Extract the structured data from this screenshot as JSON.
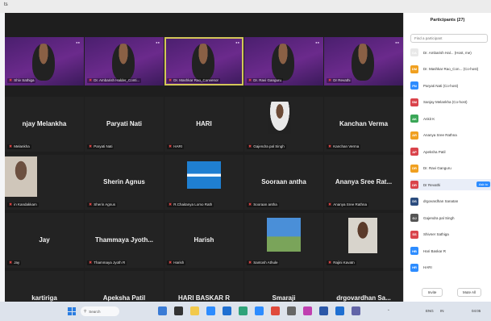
{
  "window": {
    "title_fragment": "ts"
  },
  "participants_panel": {
    "title": "Participants (27)",
    "search_placeholder": "Find a participant",
    "participants": [
      {
        "initials": "DA",
        "name": "Dr. Ambarish Hal... (Host, me)",
        "color": "#e8e8e8"
      },
      {
        "initials": "DM",
        "name": "Dr. Mashkar Rao_Con... (Co-host)",
        "color": "#f0a020"
      },
      {
        "initials": "PN",
        "name": "Paryati Nati (Co-host)",
        "color": "#2d8cff"
      },
      {
        "initials": "SM",
        "name": "Sanjay Melankha (Co-host)",
        "color": "#d9434b"
      },
      {
        "initials": "AK",
        "name": "Ankit K",
        "color": "#3aa657"
      },
      {
        "initials": "AR",
        "name": "Ananya Sree Rathna",
        "color": "#f0a020"
      },
      {
        "initials": "AP",
        "name": "Apeksha Patil",
        "color": "#d9434b"
      },
      {
        "initials": "DR",
        "name": "Dr. Ravi Ganguru",
        "color": "#f0a020"
      },
      {
        "initials": "DR",
        "name": "Dr Revathi",
        "color": "#d9434b",
        "action": "Ask to"
      },
      {
        "initials": "DS",
        "name": "drgovardhan Sanatan",
        "color": "#2b4c7e"
      },
      {
        "initials": "GJ",
        "name": "Gajendra pal Singh",
        "color": "#555555"
      },
      {
        "initials": "SS",
        "name": "Shivner Sathiga",
        "color": "#d9434b"
      },
      {
        "initials": "HB",
        "name": "Hari Baskar R",
        "color": "#2d8cff"
      },
      {
        "initials": "HR",
        "name": "HARI",
        "color": "#2d8cff"
      }
    ],
    "invite_label": "Invite",
    "mute_all_label": "Mute All"
  },
  "gallery": {
    "tiles": [
      {
        "name": "",
        "label": "Shiv Sathiga",
        "style": "purple-person"
      },
      {
        "name": "",
        "label": "Dr. Ambarish Halder_Conti...",
        "style": "purple-person"
      },
      {
        "name": "",
        "label": "Dr. Mashkar Rao_Convenor",
        "style": "purple-person-active"
      },
      {
        "name": "",
        "label": "Dr. Ravi Ganguru",
        "style": "purple-person"
      },
      {
        "name": "",
        "label": "Dr Revathi",
        "style": "purple-person"
      },
      {
        "name": "njay Melankha",
        "label": "Melankha",
        "style": "dark-name"
      },
      {
        "name": "Paryati Nati",
        "label": "Paryati Nati",
        "style": "dark-name"
      },
      {
        "name": "HARI",
        "label": "HARI",
        "style": "dark-name"
      },
      {
        "name": "",
        "label": "Gajendra pal Singh",
        "style": "photo-portrait"
      },
      {
        "name": "Kanchan Verma",
        "label": "Kanchan Verma",
        "style": "dark-name"
      },
      {
        "name": "",
        "label": "in Kandakkam",
        "style": "photo-person"
      },
      {
        "name": "Sherin Agnus",
        "label": "Sherin Agnus",
        "style": "dark-name"
      },
      {
        "name": "",
        "label": "R.Chaitanya Lomo Rath",
        "style": "photo-screen"
      },
      {
        "name": "Sooraan antha",
        "label": "Sooraan antha",
        "style": "dark-name"
      },
      {
        "name": "Ananya Sree Rat...",
        "label": "Ananya Sree Rathna",
        "style": "dark-name"
      },
      {
        "name": "Jay",
        "label": "Jay",
        "style": "dark-name"
      },
      {
        "name": "Thammaya Jyoth...",
        "label": "Thammaya Jyoth R",
        "style": "dark-name"
      },
      {
        "name": "Harish",
        "label": "Harish",
        "style": "dark-name"
      },
      {
        "name": "",
        "label": "Santosh Athule",
        "style": "photo-sky"
      },
      {
        "name": "",
        "label": "Rajini Kavatn",
        "style": "photo-child"
      },
      {
        "name": "kartiriga",
        "label": "kartiriga",
        "style": "dark-name"
      },
      {
        "name": "Apeksha Patil",
        "label": "Apeksha Patil",
        "style": "dark-name"
      },
      {
        "name": "HARI BASKAR R",
        "label": "HARI BASKAR R",
        "style": "dark-name"
      },
      {
        "name": "Smaraji",
        "label": "Smaraji",
        "style": "dark-name"
      },
      {
        "name": "drgovardhan  Sa...",
        "label": "drgovardhan Sanatan",
        "style": "dark-name"
      }
    ]
  },
  "taskbar": {
    "search_label": "Search",
    "tray_left": "ENG",
    "tray_right": "IN",
    "clock": "04:05"
  },
  "colors": {
    "accent": "#2d8cff",
    "active_border": "#d4c65a",
    "purple": "#5a2580"
  }
}
